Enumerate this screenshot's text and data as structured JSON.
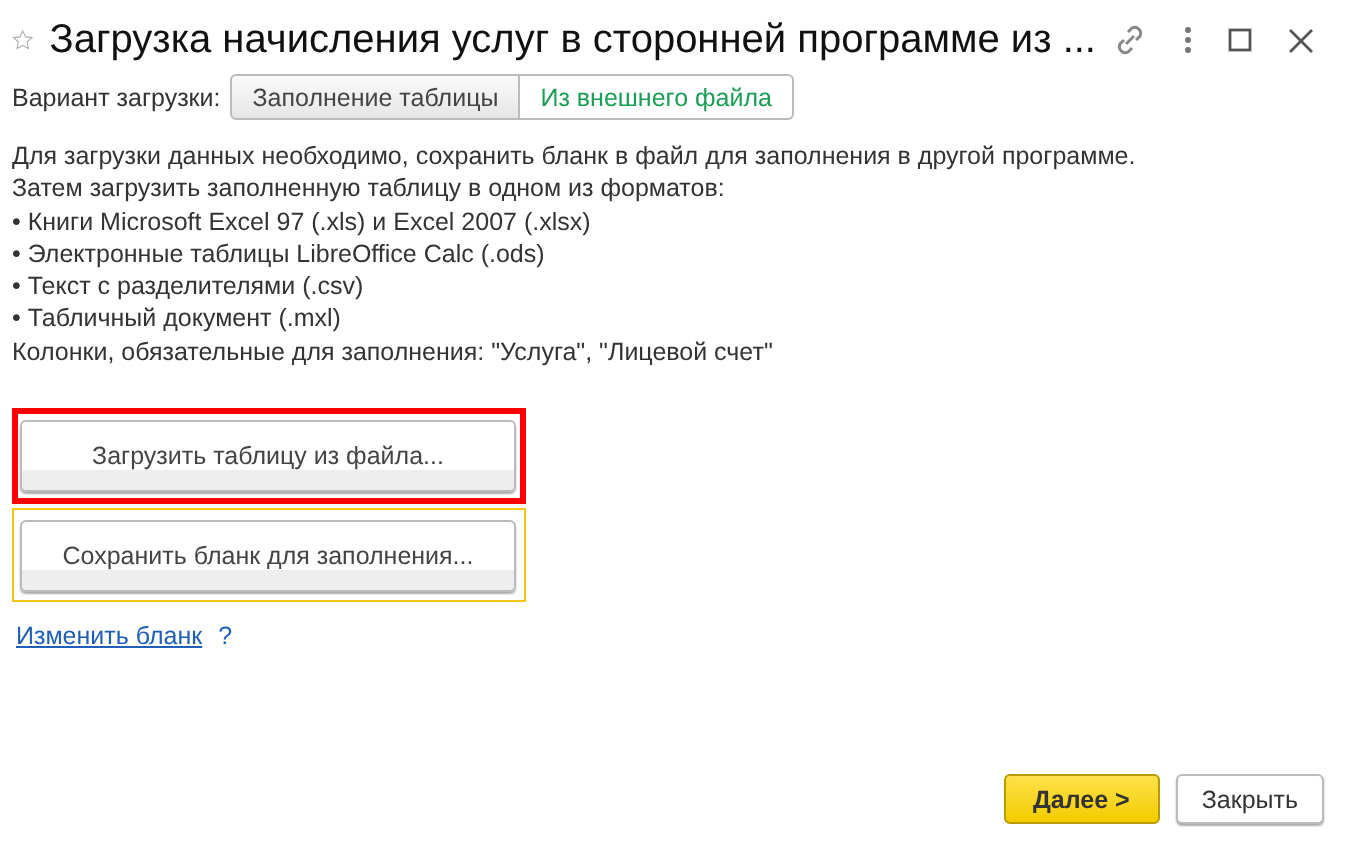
{
  "window": {
    "title": "Загрузка начисления услуг в сторонней программе из ...",
    "favorite": false
  },
  "variant": {
    "label": "Вариант загрузки:",
    "options": [
      {
        "label": "Заполнение таблицы",
        "selected": false
      },
      {
        "label": "Из внешнего файла",
        "selected": true
      }
    ]
  },
  "instructions": [
    "Для загрузки данных необходимо, сохранить бланк в файл для заполнения в другой программе.",
    "Затем загрузить заполненную таблицу в одном из форматов:",
    "• Книги Microsoft Excel 97 (.xls) и Excel 2007 (.xlsx)",
    "• Электронные таблицы LibreOffice Calc (.ods)",
    "• Текст с разделителями (.csv)",
    "• Табличный документ (.mxl)",
    "Колонки, обязательные для заполнения: \"Услуга\", \"Лицевой счет\""
  ],
  "actions": [
    {
      "label": "Загрузить таблицу из файла...",
      "highlighted": true,
      "focused": false
    },
    {
      "label": "Сохранить бланк для заполнения...",
      "highlighted": false,
      "focused": true
    }
  ],
  "edit_link": {
    "label": "Изменить бланк",
    "help": "?"
  },
  "footer": [
    {
      "label": "Далее >",
      "kind": "primary"
    },
    {
      "label": "Закрыть",
      "kind": "normal"
    }
  ]
}
